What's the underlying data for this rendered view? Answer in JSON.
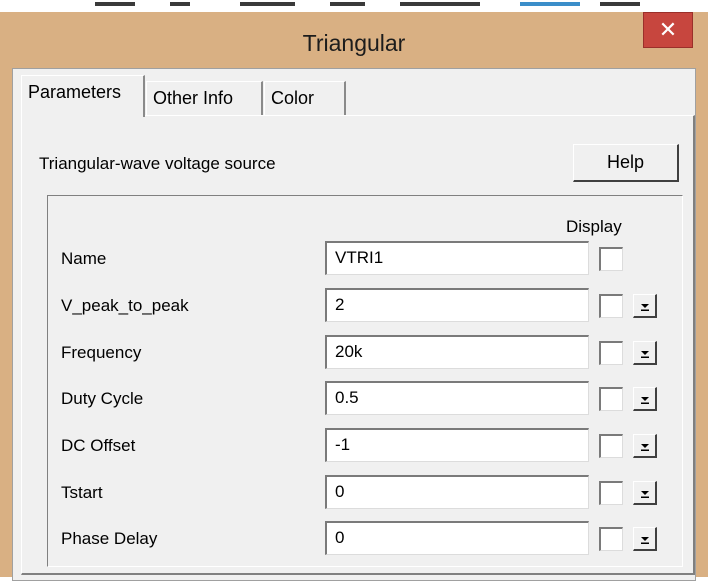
{
  "window": {
    "title": "Triangular",
    "close_glyph": "✕"
  },
  "tabs": [
    {
      "label": "Parameters",
      "active": true
    },
    {
      "label": "Other Info",
      "active": false
    },
    {
      "label": "Color",
      "active": false
    }
  ],
  "panel": {
    "description": "Triangular-wave voltage source",
    "help_label": "Help",
    "display_header": "Display"
  },
  "params": [
    {
      "label": "Name",
      "value": "VTRI1",
      "display_checked": false,
      "has_dropdown": false
    },
    {
      "label": "V_peak_to_peak",
      "value": "2",
      "display_checked": false,
      "has_dropdown": true
    },
    {
      "label": "Frequency",
      "value": "20k",
      "display_checked": false,
      "has_dropdown": true
    },
    {
      "label": "Duty Cycle",
      "value": "0.5",
      "display_checked": false,
      "has_dropdown": true
    },
    {
      "label": "DC Offset",
      "value": "-1",
      "display_checked": false,
      "has_dropdown": true
    },
    {
      "label": "Tstart",
      "value": "0",
      "display_checked": false,
      "has_dropdown": true
    },
    {
      "label": "Phase Delay",
      "value": "0",
      "display_checked": false,
      "has_dropdown": true
    }
  ],
  "colors": {
    "title_bar": "#d9b083",
    "close_button": "#c7463e",
    "dialog_bg": "#f0f0f0"
  }
}
